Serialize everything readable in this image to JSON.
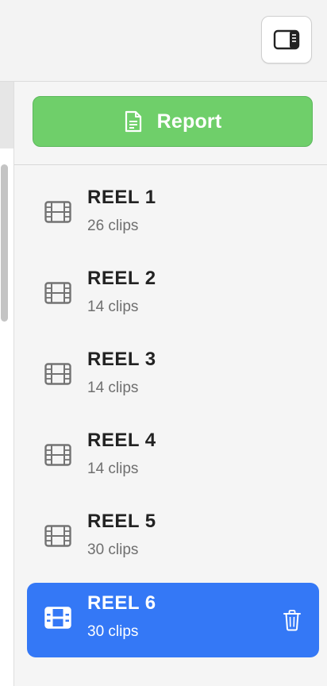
{
  "toolbar": {
    "sidebar_toggle_icon": "sidebar-right-icon"
  },
  "report": {
    "label": "Report",
    "icon": "document-icon",
    "color": "#6fcf6a"
  },
  "reels": [
    {
      "title": "REEL 1",
      "subtitle": "26 clips",
      "selected": false
    },
    {
      "title": "REEL 2",
      "subtitle": "14 clips",
      "selected": false
    },
    {
      "title": "REEL 3",
      "subtitle": "14 clips",
      "selected": false
    },
    {
      "title": "REEL 4",
      "subtitle": "14 clips",
      "selected": false
    },
    {
      "title": "REEL 5",
      "subtitle": "30 clips",
      "selected": false
    },
    {
      "title": "REEL 6",
      "subtitle": "30 clips",
      "selected": true
    }
  ],
  "colors": {
    "accent": "#3478f6",
    "report_green": "#6fcf6a"
  }
}
